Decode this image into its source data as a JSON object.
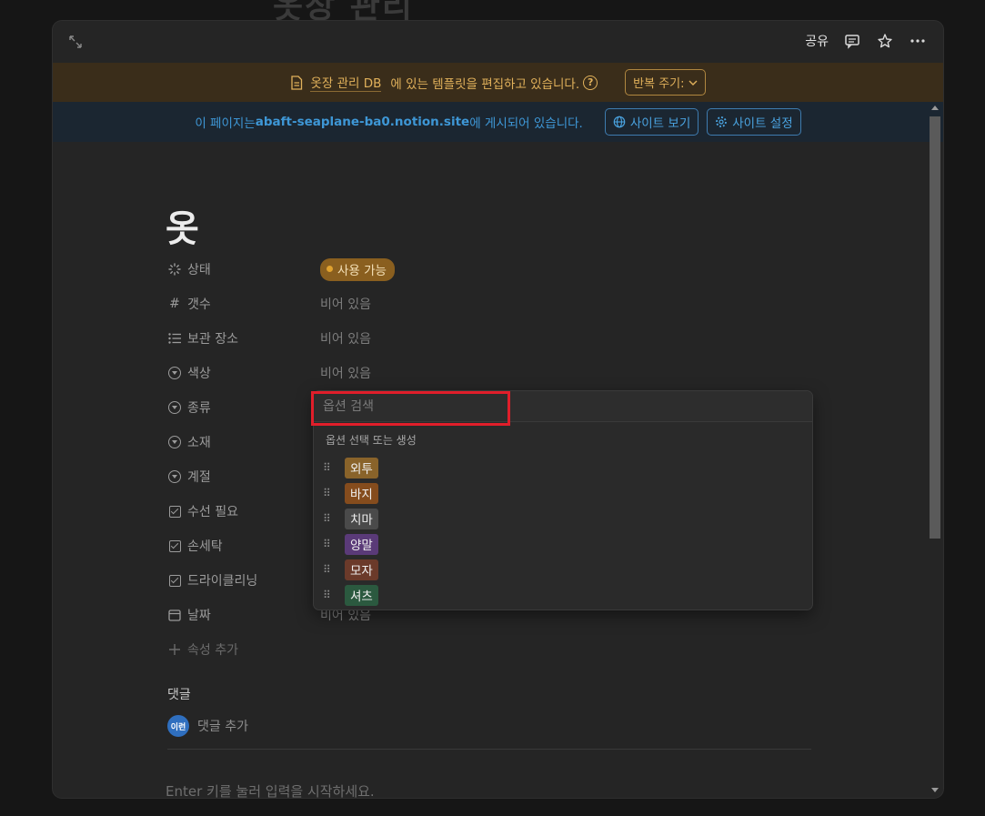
{
  "background_title": "옷장 관리",
  "topbar": {
    "share_label": "공유"
  },
  "template_banner": {
    "db_name": "옷장 관리 DB",
    "message": "에 있는 템플릿을 편집하고 있습니다.",
    "help": "?",
    "repeat_label": "반복 주기:"
  },
  "publish_banner": {
    "prefix": "이 페이지는 ",
    "site": "abaft-seaplane-ba0.notion.site",
    "suffix": "에 게시되어 있습니다.",
    "view_site": "사이트 보기",
    "site_settings": "사이트 설정"
  },
  "page": {
    "title": "옷"
  },
  "properties": [
    {
      "name": "상태",
      "icon": "status-icon",
      "value": "사용 가능"
    },
    {
      "name": "갯수",
      "icon": "number-icon",
      "value": "비어 있음"
    },
    {
      "name": "보관 장소",
      "icon": "list-icon",
      "value": "비어 있음"
    },
    {
      "name": "색상",
      "icon": "select-icon",
      "value": "비어 있음"
    },
    {
      "name": "종류",
      "icon": "select-icon",
      "value": ""
    },
    {
      "name": "소재",
      "icon": "select-icon",
      "value": ""
    },
    {
      "name": "계절",
      "icon": "select-icon",
      "value": ""
    },
    {
      "name": "수선 필요",
      "icon": "checkbox-icon",
      "value": ""
    },
    {
      "name": "손세탁",
      "icon": "checkbox-icon",
      "value": ""
    },
    {
      "name": "드라이클리닝",
      "icon": "checkbox-icon",
      "value": ""
    },
    {
      "name": "날짜",
      "icon": "calendar-icon",
      "value": "비어 있음"
    }
  ],
  "add_property": "속성 추가",
  "comments": {
    "label": "댓글",
    "avatar_text": "이런",
    "add_comment": "댓글 추가"
  },
  "enter_hint": "Enter 키를 눌러 입력을 시작하세요.",
  "dropdown": {
    "search_placeholder": "옵션 검색",
    "subtitle": "옵션 선택 또는 생성",
    "options": [
      {
        "label": "외투",
        "color": "#89632a"
      },
      {
        "label": "바지",
        "color": "#854c1d"
      },
      {
        "label": "치마",
        "color": "#4a4a4a"
      },
      {
        "label": "양말",
        "color": "#5a3a78"
      },
      {
        "label": "모자",
        "color": "#6b3a2a"
      },
      {
        "label": "셔츠",
        "color": "#2b593f"
      }
    ]
  },
  "colors": {
    "status_pill": "#8a5f1f",
    "template_banner_bg": "#3a2d1a",
    "publish_banner_bg": "#1b2631",
    "highlight": "#e01e2a"
  }
}
